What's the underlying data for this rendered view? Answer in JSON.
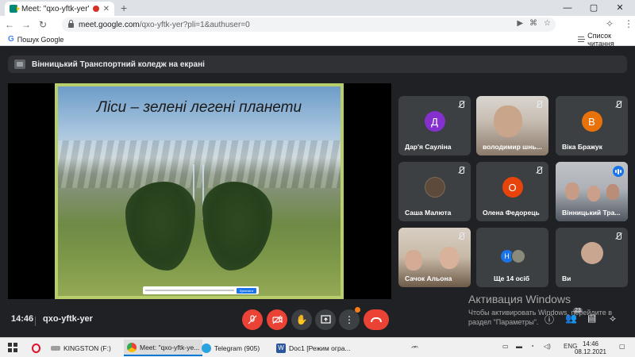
{
  "browser": {
    "tab_title": "Meet: \"qxo-yftk-yer\"",
    "url_host": "meet.google.com",
    "url_path": "/qxo-yftk-yer?pli=1&authuser=0",
    "bookmark_search": "Пошук Google",
    "reading_list": "Список читання"
  },
  "meet": {
    "presenter_chip": "Вінницький Транспортний коледж на екрані",
    "slide_title": "Ліси – зелені легені планети",
    "share_bar_stop": "Зупинити",
    "time": "14:46",
    "meeting_code": "qxo-yftk-yer",
    "participants": [
      {
        "name": "Дар'я Сауліна",
        "initial": "Д",
        "color": "#8430ce"
      },
      {
        "name": "володимир шнь...",
        "initial": "",
        "color": ""
      },
      {
        "name": "Віка Бражук",
        "initial": "В",
        "color": "#e8710a"
      },
      {
        "name": "Саша Малюта",
        "initial": "",
        "color": ""
      },
      {
        "name": "Олена Федорець",
        "initial": "О",
        "color": "#e8430a"
      },
      {
        "name": "Вінницький Тра...",
        "initial": "",
        "color": ""
      },
      {
        "name": "Сачок Альона",
        "initial": "",
        "color": ""
      },
      {
        "name": "Ще 14 осіб",
        "initial": "Н",
        "color": "#1a73e8"
      },
      {
        "name": "Ви",
        "initial": "",
        "color": ""
      }
    ],
    "people_badge": "23"
  },
  "windows": {
    "activation_title": "Активация Windows",
    "activation_text": "Чтобы активировать Windows, перейдите в раздел \"Параметры\".",
    "taskbar": {
      "kingston": "KINGSTON (F:)",
      "chrome": "Meet: \"qxo-yftk-ye...",
      "telegram": "Telegram (905)",
      "word": "Doc1 [Режим огра...",
      "lang": "ENG",
      "time": "14:46",
      "date": "08.12.2021"
    }
  },
  "colors": {
    "meet_bg": "#202124",
    "tile_bg": "#3c4043",
    "red": "#ea4335",
    "accent": "#1a73e8"
  }
}
